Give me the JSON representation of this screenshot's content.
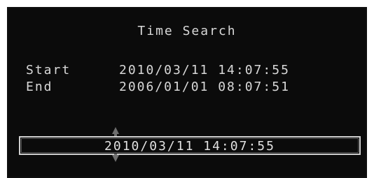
{
  "dialog": {
    "title": "Time Search"
  },
  "rows": {
    "start": {
      "label": "Start",
      "value": "2010/03/11 14:07:55"
    },
    "end": {
      "label": "End",
      "value": "2006/01/01 08:07:51"
    }
  },
  "search": {
    "value": "2010/03/11 14:07:55"
  },
  "icons": {
    "up": "arrow-up-icon",
    "down": "arrow-down-icon"
  },
  "colors": {
    "background": "#0b0b0b",
    "text": "#d8d8d8",
    "border": "#cfcfcf",
    "arrow": "#6e6e6e"
  }
}
